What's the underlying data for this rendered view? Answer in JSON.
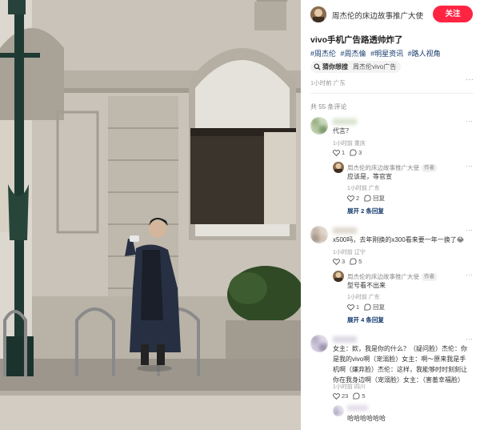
{
  "author": {
    "name": "周杰伦的床边故事推广大使",
    "follow_label": "关注"
  },
  "post": {
    "title": "vivo手机广告路透帅炸了",
    "tags": [
      "#周杰伦",
      "#周杰倫",
      "#明星资讯",
      "#路人视角"
    ],
    "search": {
      "label": "猜你想搜",
      "query": "周杰伦vivo广告"
    },
    "meta": "1小时前 广东",
    "more_label": "···"
  },
  "comments_header": "共 55 条评论",
  "comments": [
    {
      "text": "代言？",
      "meta": "1小时前 重庆",
      "likes": "1",
      "replies": "3",
      "reply": {
        "name": "周杰伦的床边故事推广大使",
        "badge": "作者",
        "text": "应该是，等官宣",
        "meta": "1小时前 广东",
        "likes": "2",
        "reply_label": "回复"
      },
      "expand": "展开 2 条回复"
    },
    {
      "text": "x500吗，去年刚换的x300看来要一年一换了😂",
      "meta": "1小时前 辽宁",
      "likes": "3",
      "replies": "5",
      "reply": {
        "name": "周杰伦的床边故事推广大使",
        "badge": "作者",
        "text": "型号看不出来",
        "meta": "1小时前 广东",
        "likes": "1",
        "reply_label": "回复"
      },
      "expand": "展开 4 条回复"
    },
    {
      "text": "女主：欸，我是你的什么？（疑问脸）杰伦：你是我的vivo啊（宠溺脸）女主：啊～原来我是手机啊（嫌弃脸）杰伦：这样，我能够时时刻刻让你在我身边啊（宠溺脸）女主：（害羞幸福脸）",
      "meta": "1小时前 四川",
      "likes": "23",
      "replies": "5",
      "reply": {
        "text": "哈哈哈哈哈哈"
      }
    }
  ],
  "icons": {
    "heart": "heart-icon",
    "comment": "comment-icon",
    "search": "search-icon",
    "more": "more-icon"
  },
  "colors": {
    "accent": "#ff2442",
    "link": "#13386c",
    "meta": "#999999"
  }
}
